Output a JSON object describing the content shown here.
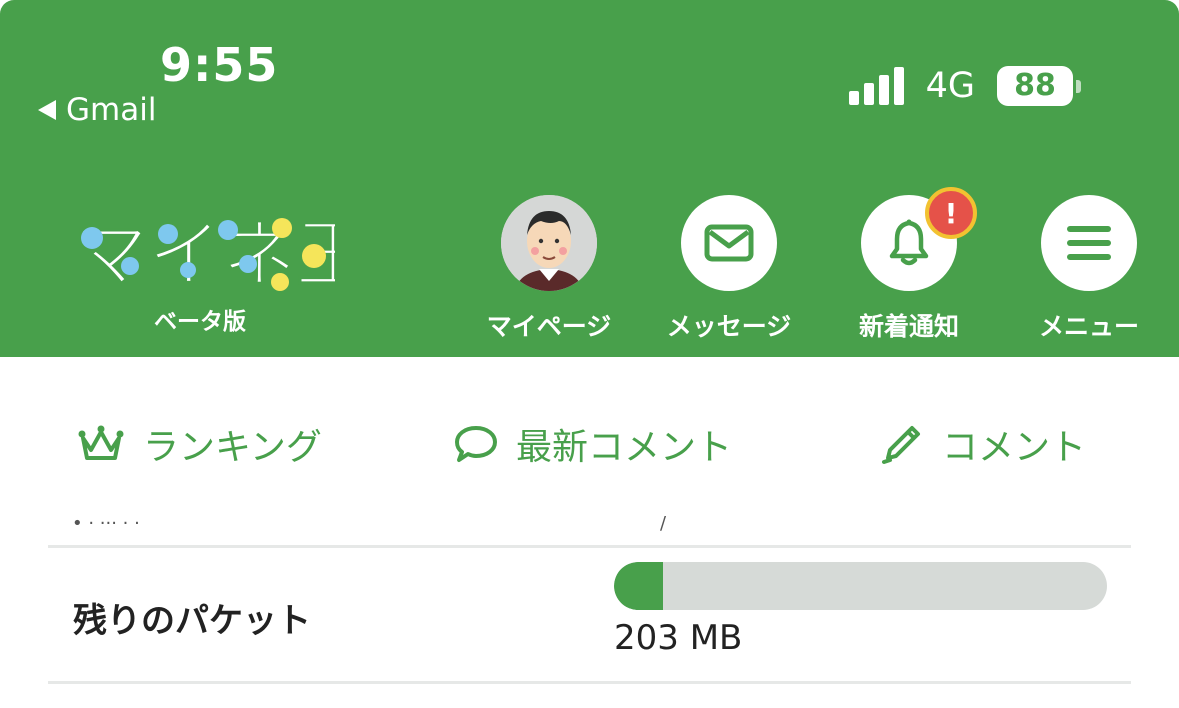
{
  "status_bar": {
    "time": "9:55",
    "back_app": "Gmail",
    "network": "4G",
    "battery": "88"
  },
  "brand": {
    "logo_text": "マイネ王",
    "beta_label": "ベータ版",
    "color": "#48a04b"
  },
  "nav": [
    {
      "label": "マイページ",
      "icon": "avatar-icon"
    },
    {
      "label": "メッセージ",
      "icon": "envelope-icon"
    },
    {
      "label": "新着通知",
      "icon": "bell-icon",
      "badge": "!"
    },
    {
      "label": "メニュー",
      "icon": "hamburger-icon"
    }
  ],
  "tabs": [
    {
      "label": "ランキング",
      "icon": "crown-icon"
    },
    {
      "label": "最新コメント",
      "icon": "speech-bubble-icon"
    },
    {
      "label": "コメント",
      "icon": "pencil-icon"
    }
  ],
  "packet": {
    "label": "残りのパケット",
    "value": "203 MB",
    "fill_fraction": 0.1
  },
  "partial_row": {
    "left": "• · ··· · ·",
    "right": "/"
  }
}
